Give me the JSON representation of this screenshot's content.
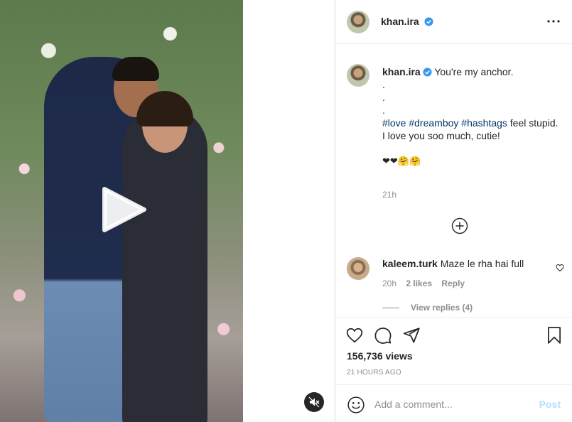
{
  "post": {
    "username": "khan.ira",
    "caption": {
      "lines": [
        "You're my anchor.",
        ".",
        ".",
        "."
      ],
      "hashtags": [
        "#love",
        "#dreamboy",
        "#hashtags"
      ],
      "after_hashtags": "feel stupid.",
      "line_love": "I love you soo much, cutie!",
      "emojis": "❤❤🤗🤗"
    },
    "time_short": "21h",
    "views": "156,736 views",
    "time_ago": "21 HOURS AGO"
  },
  "comment": {
    "username": "kaleem.turk",
    "text": "Maze le rha hai full",
    "time": "20h",
    "likes": "2 likes",
    "reply_label": "Reply",
    "view_replies": "View replies (4)"
  },
  "composer": {
    "placeholder": "Add a comment...",
    "post_label": "Post"
  },
  "colors": {
    "verified": "#3897f0",
    "hashtag": "#00376b",
    "post_button": "#b2dffc"
  },
  "icons": [
    "verified-badge-icon",
    "more-options-icon",
    "play-icon",
    "muted-speaker-icon",
    "plus-circle-icon",
    "heart-icon",
    "comment-icon",
    "share-icon",
    "bookmark-icon",
    "emoji-icon"
  ]
}
